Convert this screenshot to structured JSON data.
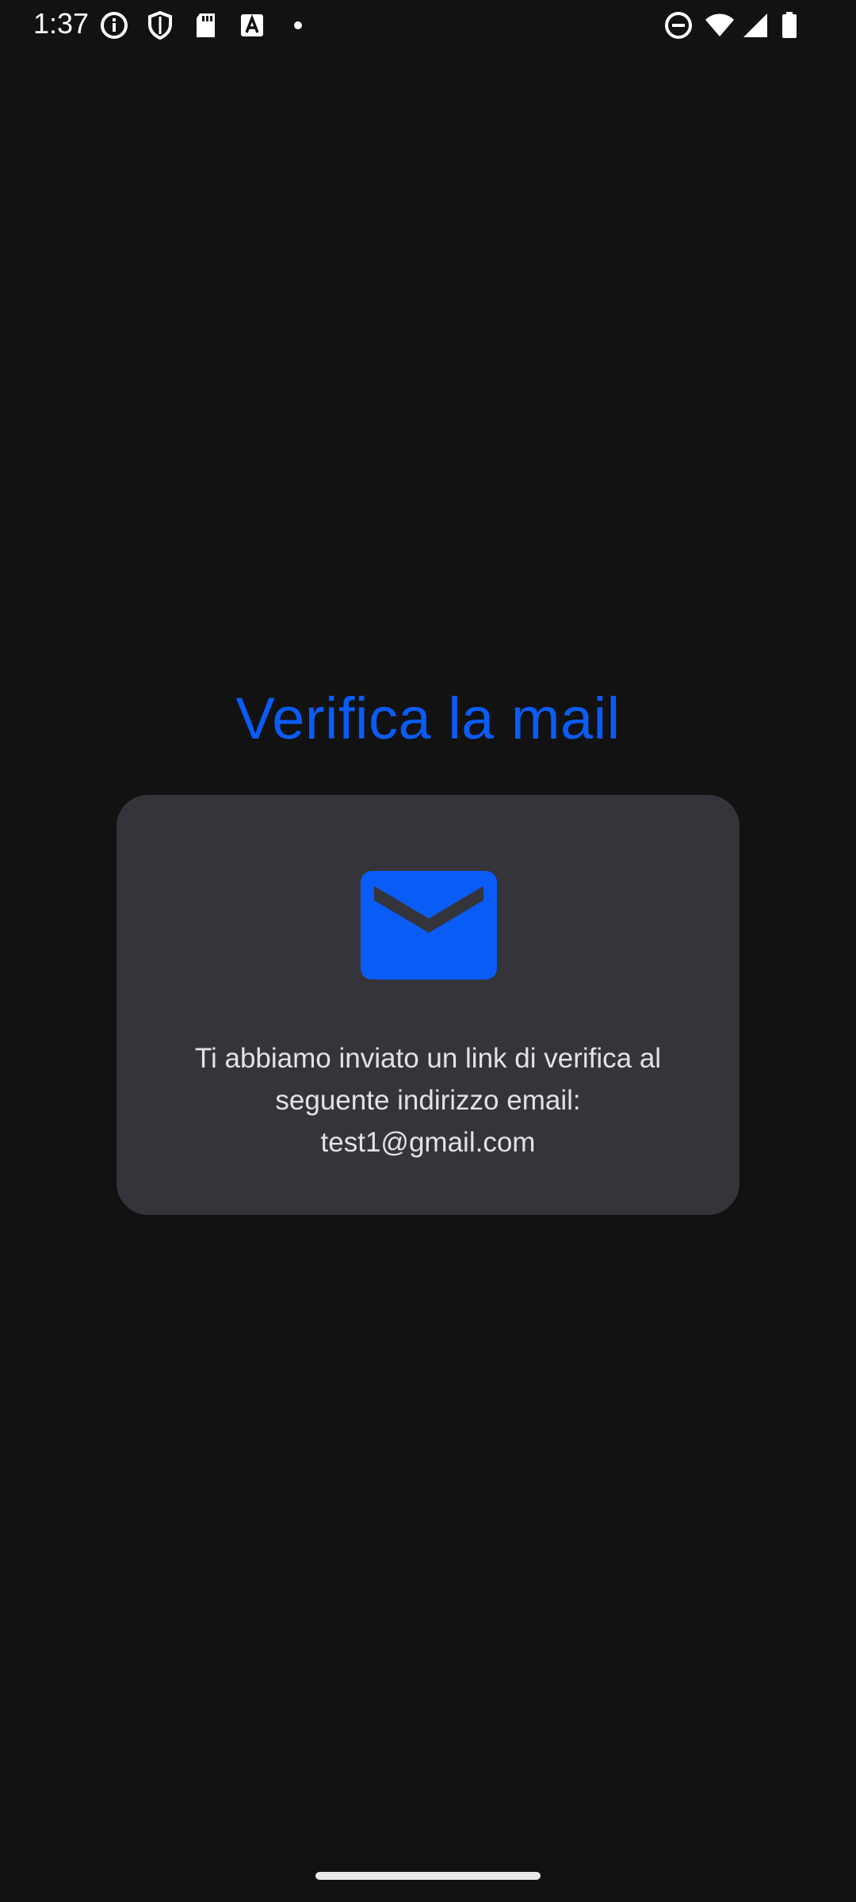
{
  "status_bar": {
    "time": "1:37",
    "icons_left": [
      "info-icon",
      "shield-icon",
      "sd-card-icon",
      "text-a-icon",
      "notification-dot-icon"
    ],
    "icons_right": [
      "do-not-disturb-icon",
      "wifi-icon",
      "signal-icon",
      "battery-icon"
    ]
  },
  "main": {
    "title": "Verifica la mail",
    "card": {
      "icon": "mail-icon",
      "message_line1": "Ti abbiamo inviato un link di verifica al",
      "message_line2": "seguente indirizzo email:",
      "email": "test1@gmail.com"
    }
  },
  "colors": {
    "background": "#121213",
    "accent": "#0a5cf7",
    "card": "#35343b",
    "text": "#e6e1e5"
  }
}
